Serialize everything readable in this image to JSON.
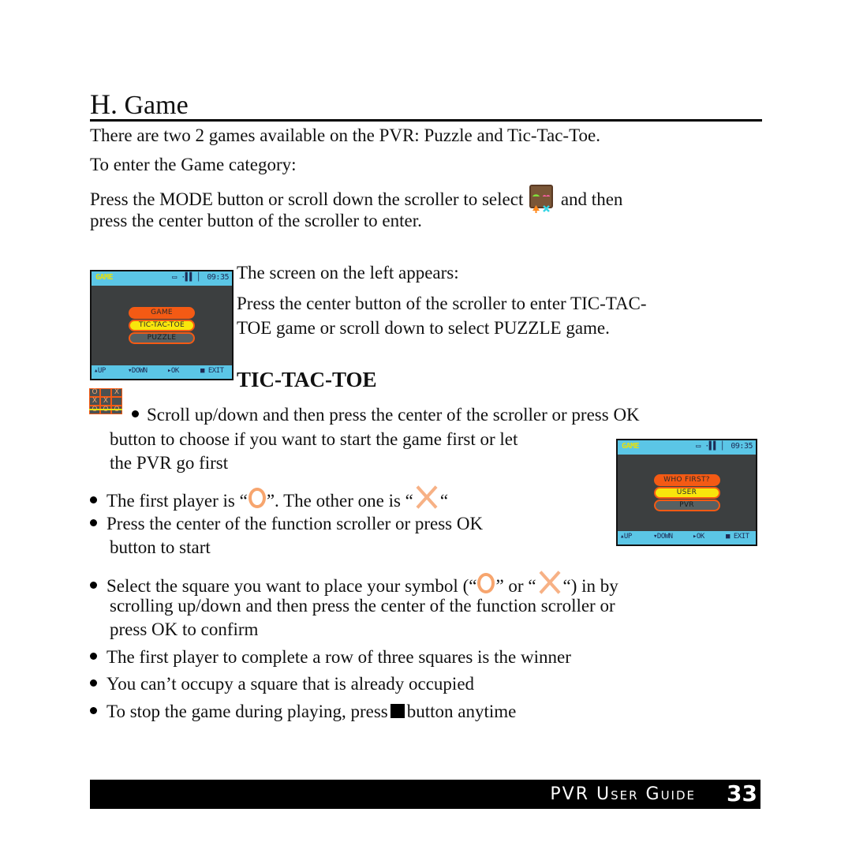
{
  "section": {
    "letter": "H.",
    "title": "Game"
  },
  "intro": {
    "line1": "There are two 2 games available on the PVR:  Puzzle and Tic-Tac-Toe.",
    "line2": "To enter the Game category:",
    "line3_before_icon": "Press the MODE button or scroll down the scroller to select",
    "line3_after_icon": "and then",
    "line4": "press the center button of the scroller to enter.",
    "game_icon": "game-category-icon"
  },
  "screen1": {
    "mode_tag": "GAME",
    "status": "▭ ·▌▌ ▏ 09:35",
    "menu_title": "GAME",
    "menu_items": [
      "TIC-TAC-TOE",
      "PUZZLE"
    ],
    "selected_index": 0,
    "footer": [
      "▴UP",
      "▾DOWN",
      "▸OK",
      "■ EXIT"
    ]
  },
  "screen1_text": {
    "line1": "The screen on the left appears:",
    "line2": "Press the center button of the scroller to enter TIC-TAC-",
    "line3": "TOE game or scroll down to select PUZZLE game."
  },
  "subsection": {
    "title": "TIC-TAC-TOE",
    "icon_board": [
      "O",
      "",
      "X",
      "X",
      "X",
      "",
      "O",
      "O",
      "O"
    ]
  },
  "bullets": {
    "b1_line1": "Scroll up/down and then press the center of the scroller or press OK",
    "b1_line2": "button to choose if you want to start the game first or let",
    "b1_line3": "the PVR go first",
    "b2_before_o": "The first player is “",
    "b2_between": "”. The other one is “",
    "b2_after_x": "“",
    "b3_line1": "Press the center of the function scroller or press OK",
    "b3_line2": "button to start",
    "b4_before_o": "Select the square you want to place your symbol (“",
    "b4_between": "” or “",
    "b4_after_x": "“) in by",
    "b4_line2": "scrolling up/down and then press the center of the function scroller or",
    "b4_line3": "press OK to confirm",
    "b5": "The first player to complete a row of three squares is the winner",
    "b6": "You can’t occupy a square that is already occupied",
    "b7_before": "To stop the game during playing,  press",
    "b7_after": "button anytime"
  },
  "screen2": {
    "mode_tag": "GAME",
    "status": "▭ ·▌▌ ▏ 09:35",
    "menu_title": "WHO FIRST?",
    "menu_items": [
      "USER",
      "PVR"
    ],
    "selected_index": 0,
    "footer": [
      "▴UP",
      "▾DOWN",
      "▸OK",
      "■ EXIT"
    ]
  },
  "footer": {
    "title": "PVR User Guide",
    "page": "33"
  },
  "colors": {
    "screen_bar": "#5bc6e6",
    "screen_bg": "#3c3f40",
    "menu_orange": "#f45a14",
    "menu_selected": "#f8e60c",
    "symbol_orange": "#f7a56e"
  }
}
